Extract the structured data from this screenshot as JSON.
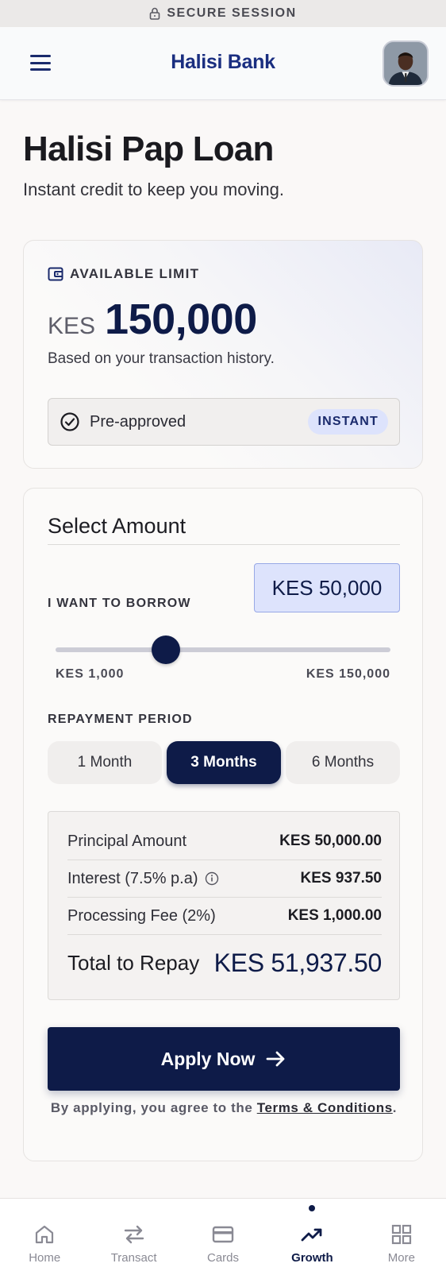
{
  "security": {
    "label": "SECURE SESSION",
    "icon": "lock-icon"
  },
  "header": {
    "title": "Halisi Bank",
    "menu_icon": "hamburger-menu-icon",
    "avatar_icon": "user-avatar"
  },
  "page": {
    "title": "Halisi Pap Loan",
    "subtitle": "Instant credit to keep you moving."
  },
  "limit": {
    "label": "AVAILABLE LIMIT",
    "currency": "KES",
    "amount": "150,000",
    "note": "Based on your transaction history.",
    "status_text": "Pre-approved",
    "badge": "INSTANT"
  },
  "amount": {
    "section_title": "Select Amount",
    "borrow_label": "I WANT TO BORROW",
    "borrow_value": "KES 50,000",
    "slider_min_label": "KES 1,000",
    "slider_max_label": "KES 150,000",
    "slider_value_fraction": 0.33,
    "period_label": "REPAYMENT PERIOD",
    "periods": [
      {
        "label": "1 Month",
        "active": false
      },
      {
        "label": "3 Months",
        "active": true
      },
      {
        "label": "6 Months",
        "active": false
      }
    ]
  },
  "summary": {
    "rows": [
      {
        "label": "Principal Amount",
        "value": "KES 50,000.00"
      },
      {
        "label": "Interest (7.5% p.a)",
        "value": "KES 937.50",
        "info_icon": "info-icon"
      },
      {
        "label": "Processing Fee (2%)",
        "value": "KES 1,000.00"
      }
    ],
    "total_label": "Total to Repay",
    "total_value": "KES 51,937.50"
  },
  "cta": {
    "apply_label": "Apply Now",
    "terms_prefix": "By applying, you agree to the ",
    "terms_link": "Terms & Conditions",
    "terms_suffix": "."
  },
  "nav": {
    "items": [
      {
        "label": "Home",
        "icon": "home-icon",
        "active": false
      },
      {
        "label": "Transact",
        "icon": "transfer-arrows-icon",
        "active": false
      },
      {
        "label": "Cards",
        "icon": "credit-card-icon",
        "active": false
      },
      {
        "label": "Growth",
        "icon": "trending-up-icon",
        "active": true
      },
      {
        "label": "More",
        "icon": "grid-icon",
        "active": false
      }
    ]
  },
  "colors": {
    "primary": "#0e1b48",
    "accent_light": "#dde3fc",
    "brand_text": "#1a2e80",
    "background": "#faf8f7"
  }
}
